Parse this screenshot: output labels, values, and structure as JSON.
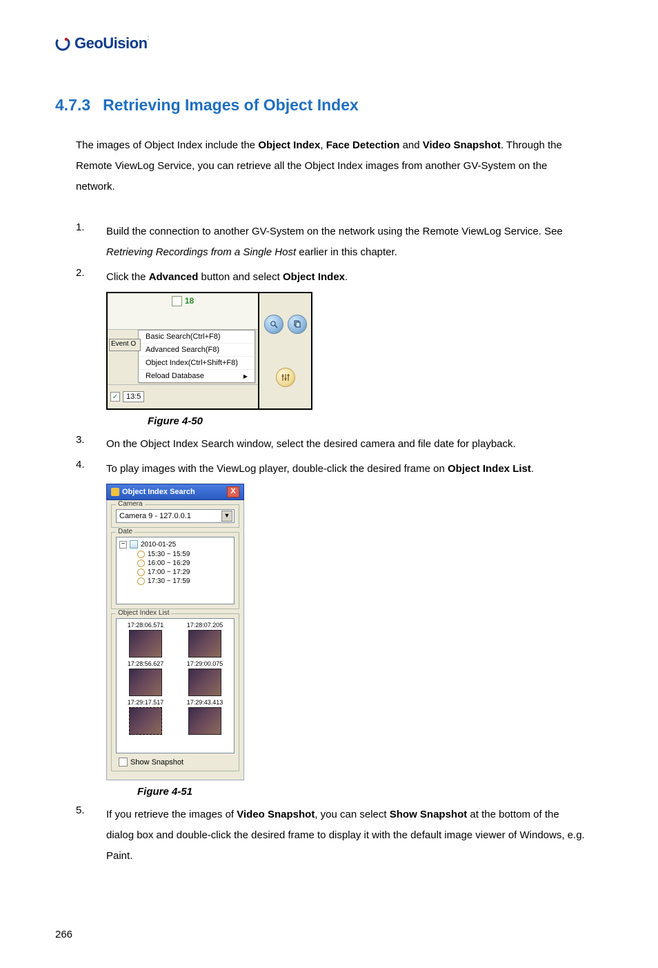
{
  "logo": {
    "text": "GeoUision"
  },
  "heading": {
    "number": "4.7.3",
    "title": "Retrieving Images of Object Index"
  },
  "intro": {
    "p1a": "The images of Object Index include the ",
    "b1": "Object Index",
    "comma1": ", ",
    "b2": "Face Detection",
    "and": " and ",
    "b3": "Video Snapshot",
    "p1b": ". Through the Remote ViewLog Service, you can retrieve all the Object Index images from another GV-System on the network."
  },
  "steps": {
    "s1a": "Build the connection to another GV-System on the network using the Remote ViewLog Service. See ",
    "s1i": "Retrieving Recordings from a Single Host",
    "s1b": " earlier in this chapter.",
    "s2a": "Click the ",
    "s2b": "Advanced",
    "s2c": " button and select ",
    "s2d": "Object Index",
    "s2e": ".",
    "s3": "On the Object Index Search window, select the desired camera and file date for playback.",
    "s4a": "To play images with the ViewLog player, double-click the desired frame on ",
    "s4b": "Object Index List",
    "s4c": ".",
    "s5a": "If you retrieve the images of ",
    "s5b": "Video Snapshot",
    "s5c": ", you can select ",
    "s5d": "Show Snapshot",
    "s5e": " at the bottom of the dialog box and double-click the desired frame to display it with the default image viewer of Windows, e.g. Paint."
  },
  "fig50": {
    "caption": "Figure 4-50",
    "count": "18",
    "event_btn": "Event O",
    "menu": {
      "basic": "Basic Search(Ctrl+F8)",
      "advanced": "Advanced Search(F8)",
      "objidx": "Object Index(Ctrl+Shift+F8)",
      "reload": "Reload Database",
      "arrow": "▶"
    },
    "time_chk": "✓",
    "time": "13:5"
  },
  "fig51": {
    "caption": "Figure 4-51",
    "title": "Object Index Search",
    "close": "X",
    "camera_label": "Camera",
    "camera_value": "Camera 9 - 127.0.0.1",
    "date_label": "Date",
    "date_value": "2010-01-25",
    "times": {
      "t1": "15:30 ~ 15:59",
      "t2": "16:00 ~ 16:29",
      "t3": "17:00 ~ 17:29",
      "t4": "17:30 ~ 17:59"
    },
    "list_label": "Object Index List",
    "thumbs": {
      "ts1": "17:28:06.571",
      "ts2": "17:28:07.205",
      "ts3": "17:28:56.627",
      "ts4": "17:29:00.075",
      "ts5": "17:29:17.517",
      "ts6": "17:29:43.413"
    },
    "show_snapshot": "Show Snapshot"
  },
  "page_number": "266"
}
